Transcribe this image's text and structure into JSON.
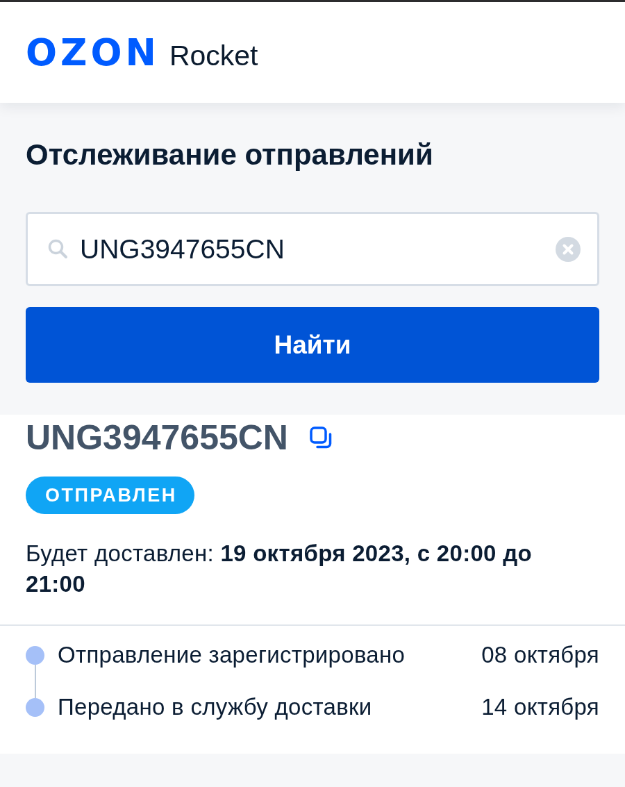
{
  "header": {
    "logo_mark": "OZON",
    "logo_text": "Rocket"
  },
  "tracking": {
    "title": "Отслеживание отправлений",
    "search": {
      "value": "UNG3947655CN"
    },
    "search_button": "Найти"
  },
  "shipment": {
    "number": "UNG3947655CN",
    "status": "ОТПРАВЛЕН",
    "delivery": "Будет доставлен: **19 октября 2023, с 20:00 до 21:00**",
    "events": [
      {
        "label": "Отправление зарегистрировано",
        "date": "08 октября"
      },
      {
        "label": "Передано в службу доставки",
        "date": "14 октября"
      }
    ]
  }
}
